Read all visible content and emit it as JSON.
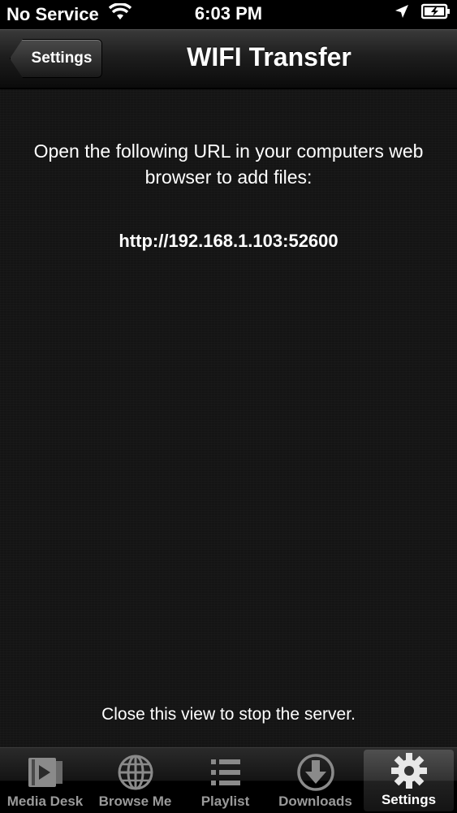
{
  "status_bar": {
    "carrier": "No Service",
    "time": "6:03 PM"
  },
  "nav": {
    "back_label": "Settings",
    "title": "WIFI Transfer"
  },
  "content": {
    "instructions": "Open the following URL in your computers web browser to add files:",
    "url": "http://192.168.1.103:52600",
    "footer_note": "Close this view to stop the server."
  },
  "tabs": [
    {
      "label": "Media Desk",
      "icon": "media-desk-icon",
      "active": false
    },
    {
      "label": "Browse Me",
      "icon": "globe-icon",
      "active": false
    },
    {
      "label": "Playlist",
      "icon": "list-icon",
      "active": false
    },
    {
      "label": "Downloads",
      "icon": "download-icon",
      "active": false
    },
    {
      "label": "Settings",
      "icon": "gear-icon",
      "active": true
    }
  ],
  "colors": {
    "background": "#141414",
    "text": "#ffffff",
    "tab_inactive": "#9a9a9a"
  }
}
